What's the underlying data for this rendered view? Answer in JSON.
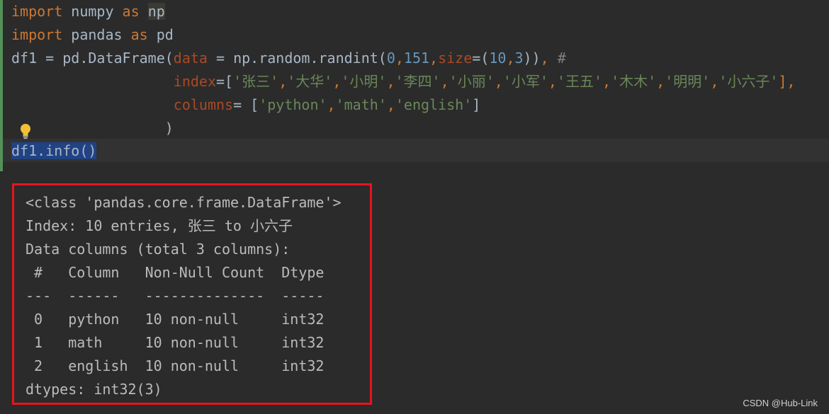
{
  "code": {
    "l1": {
      "kw1": "import",
      "mod": " numpy ",
      "kw2": "as",
      "sp": " ",
      "alias": "np"
    },
    "l2": {
      "kw1": "import",
      "mod": " pandas ",
      "kw2": "as",
      "alias": " pd"
    },
    "l3": {
      "a": "df1 = pd.DataFrame(",
      "p1": "data",
      "b": " = np.random.randint(",
      "n1": "0",
      "c1": ",",
      "n2": "151",
      "c2": ",",
      "p2": "size",
      "d": "=(",
      "n3": "10",
      "c3": ",",
      "n4": "3",
      "e": "))",
      "f": ", ",
      "cmt": "#"
    },
    "l4": {
      "indent": "                   ",
      "p": "index",
      "eq": "=[",
      "items": [
        "'张三'",
        "'大华'",
        "'小明'",
        "'李四'",
        "'小丽'",
        "'小军'",
        "'王五'",
        "'木木'",
        "'明明'",
        "'小六子'"
      ],
      "comma": ",",
      "close": "],"
    },
    "l5": {
      "indent": "                   ",
      "p": "columns",
      "eq": "= [",
      "s1": "'python'",
      "s2": "'math'",
      "s3": "'english'",
      "comma": ",",
      "close": "]"
    },
    "l6": {
      "indent": "                  ",
      "t": ")"
    },
    "l7": {
      "t": "df1.info()"
    }
  },
  "output": {
    "lines": [
      "<class 'pandas.core.frame.DataFrame'>",
      "Index: 10 entries, 张三 to 小六子",
      "Data columns (total 3 columns):",
      " #   Column   Non-Null Count  Dtype",
      "---  ------   --------------  -----",
      " 0   python   10 non-null     int32",
      " 1   math     10 non-null     int32",
      " 2   english  10 non-null     int32",
      "dtypes: int32(3)"
    ]
  },
  "watermark": "CSDN @Hub-Link",
  "colors": {
    "keyword": "#cc7832",
    "param": "#aa4926",
    "number": "#6897bb",
    "string": "#6a8759",
    "output_border": "#e8141b",
    "selection": "#214283"
  },
  "icons": {
    "bulb": "lightbulb-icon"
  }
}
